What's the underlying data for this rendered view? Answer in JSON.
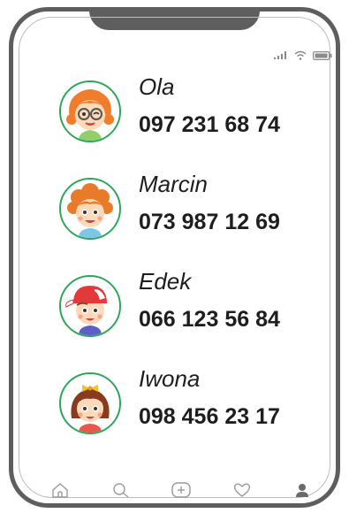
{
  "contacts": [
    {
      "name": "Ola",
      "phone": "097 231 68 74",
      "avatar": "girl-glasses-avatar",
      "hair": "#f07c2c",
      "shirt": "#8fd06a"
    },
    {
      "name": "Marcin",
      "phone": "073 987 12 69",
      "avatar": "boy-curly-avatar",
      "hair": "#e87b2a",
      "shirt": "#7cc6e8"
    },
    {
      "name": "Edek",
      "phone": "066 123 56 84",
      "avatar": "boy-cap-avatar",
      "hair": "#7a4a2a",
      "shirt": "#5b5fc7"
    },
    {
      "name": "Iwona",
      "phone": "098 456 23 17",
      "avatar": "girl-bow-avatar",
      "hair": "#8a3a1e",
      "shirt": "#e9564a"
    }
  ],
  "colors": {
    "frame": "#5e5e5e",
    "avatar_ring": "#2ea65a",
    "text": "#1e1e1e",
    "icon": "#9a9a9a"
  },
  "status_icons": [
    "signal-icon",
    "wifi-icon",
    "battery-icon"
  ],
  "nav_icons": [
    "home-icon",
    "search-icon",
    "add-icon",
    "heart-icon",
    "profile-icon"
  ]
}
